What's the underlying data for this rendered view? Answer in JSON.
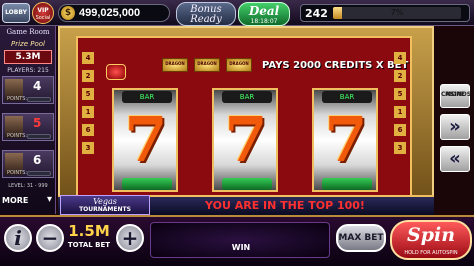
{
  "topbar": {
    "lobby_label": "LOBBY",
    "vip_title": "VIP",
    "vip_sub": "Social",
    "coins": "499,025,000",
    "coin_symbol": "$",
    "bonus_line1": "Bonus",
    "bonus_line2": "Ready",
    "deal_label": "Deal",
    "deal_timer": "18:18:07",
    "level": "242",
    "xp_percent": "7%",
    "xp_fraction": 0.07
  },
  "left": {
    "game_room": "Game Room",
    "prize_pool_label": "Prize Pool",
    "prize_pool_value": "5.3M",
    "players": "PLAYERS: 215",
    "rows": [
      {
        "rank": "4",
        "points": "POINTS:",
        "rank_color": "#ffffff"
      },
      {
        "rank": "5",
        "points": "POINTS:",
        "rank_color": "#ff3a3a"
      },
      {
        "rank": "6",
        "points": "POINTS:",
        "rank_color": "#ffffff"
      }
    ],
    "level_range": "LEVEL: 31 - 999",
    "more": "MORE"
  },
  "machine": {
    "pays_text": "PAYS 2000 CREDITS X BET",
    "dragon_word": "DRAGON",
    "reel_bar": "BAR",
    "seven": "7",
    "paylines_left": [
      "4",
      "2",
      "5",
      "1",
      "6",
      "3"
    ],
    "paylines_right": [
      "4",
      "2",
      "5",
      "1",
      "6",
      "3"
    ]
  },
  "right": {
    "more_casinos_1": "MORE",
    "more_casinos_2": "CASINOS",
    "forward_icon": "»",
    "back_icon": "«"
  },
  "banner": {
    "brand1": "Vegas",
    "brand2": "TOURNAMENTS",
    "message": "YOU ARE IN THE TOP 100!"
  },
  "bottom": {
    "info": "i",
    "minus": "−",
    "plus": "+",
    "total_bet_value": "1.5M",
    "total_bet_label": "TOTAL BET",
    "win_label": "WIN",
    "max_bet": "MAX BET",
    "spin": "Spin",
    "spin_sub": "HOLD FOR AUTOSPIN"
  },
  "colors": {
    "accent_gold": "#f0c060",
    "seven_orange": "#f05a0a",
    "spin_red": "#d8202a",
    "message_red": "#ff3030"
  }
}
